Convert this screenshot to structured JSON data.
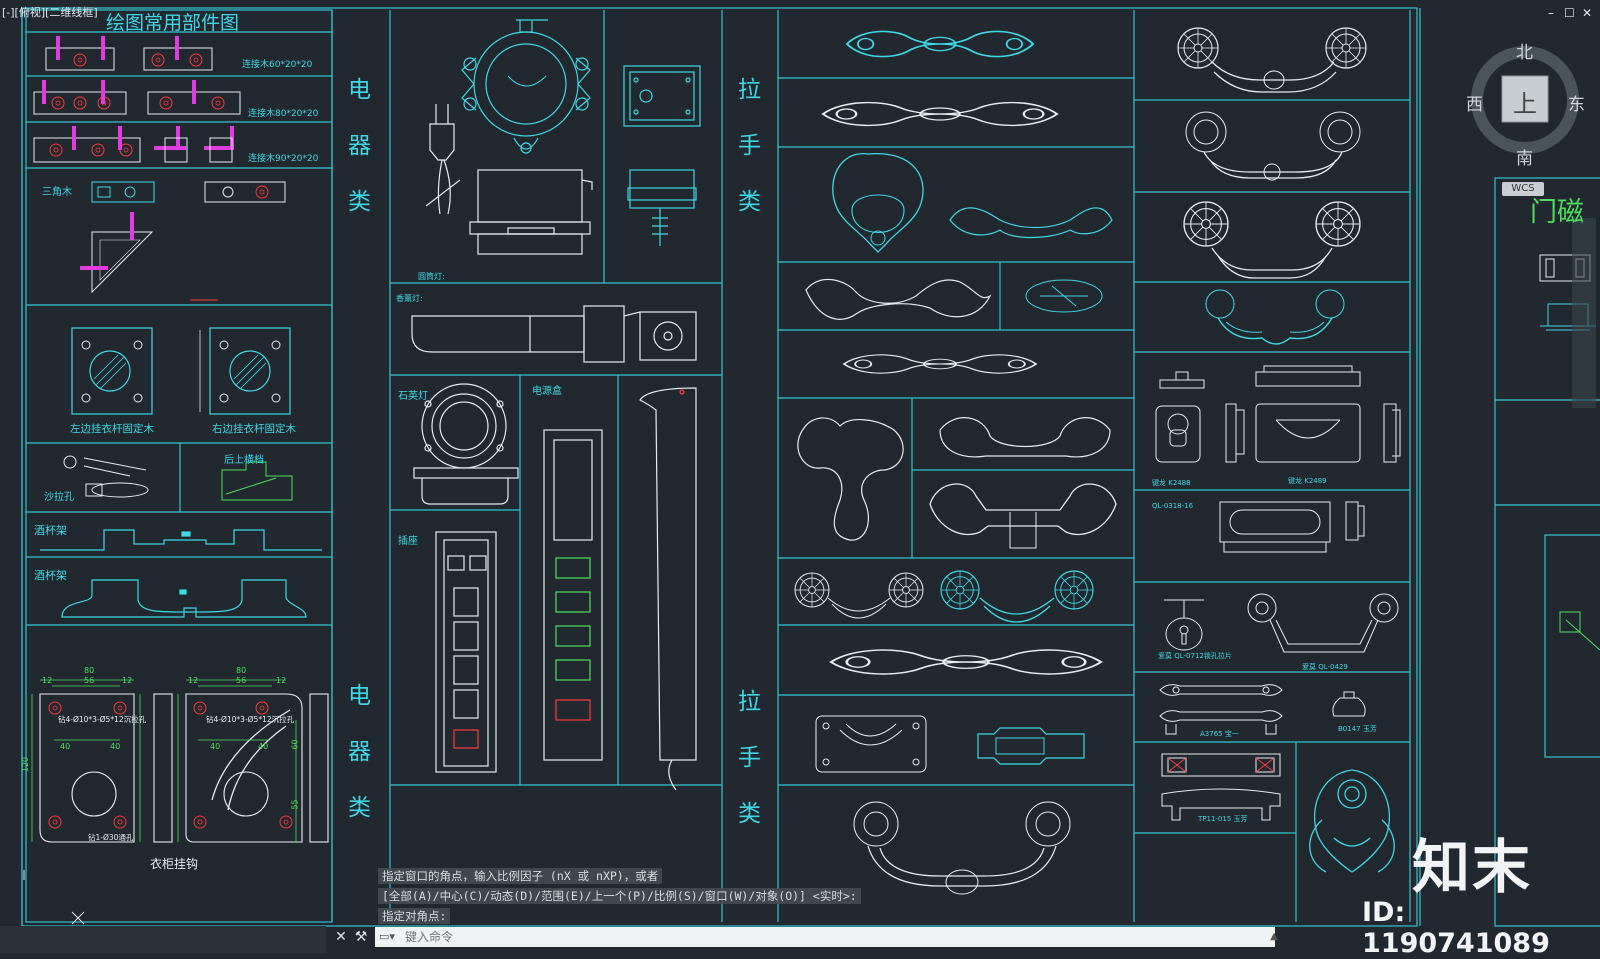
{
  "viewport_label": "[-][俯视][二维线框]",
  "window_controls": [
    "–",
    "☐",
    "✕"
  ],
  "title": "绘图常用部件图",
  "side_labels": {
    "electrical_1": [
      "电",
      "器",
      "类"
    ],
    "electrical_2": [
      "电",
      "器",
      "类"
    ],
    "handle_1": [
      "拉",
      "手",
      "类"
    ],
    "handle_2": [
      "拉",
      "手",
      "类"
    ]
  },
  "part_labels": {
    "connector_60": "连接木60*20*20",
    "connector_80": "连接木80*20*20",
    "connector_90": "连接木90*20*20",
    "triangle_wood": "三角木",
    "left_rod": "左边挂衣杆固定木",
    "right_rod": "右边挂衣杆固定木",
    "sofa_hole": "沙拉孔",
    "rear_rail": "后上横档",
    "wine_rack_1": "酒杯架",
    "wine_rack_2": "酒杯架",
    "wardrobe_hook": "衣柜挂钩",
    "round_lamp": "圆筒灯:",
    "spot_lamp": "香薰灯:",
    "quartz_lamp": "石英灯",
    "power_box": "电源盒",
    "socket": "插座",
    "handle_k2488": "键龙 K2488",
    "handle_k2489": "键龙 K2489",
    "handle_ql0318": "QL-0318-16",
    "handle_ql0712": "爱莫 QL-0712锁孔拉片",
    "handle_ql0429": "爱莫 QL-0429",
    "handle_a3765": "A3765 宝一",
    "handle_b0147": "B0147 玉芳",
    "handle_tp11": "TP11-015 玉芳",
    "door_magnet": "门磁"
  },
  "dimensions": {
    "d80": "80",
    "d56": "56",
    "d12": "12",
    "d40": "40",
    "d60": "60",
    "d120": "120",
    "d55": "55",
    "hole_note": "钻4-Ø10*3-Ø5*12沉拉孔",
    "hole_note2": "钻1-Ø30通孔"
  },
  "command_history": [
    "指定窗口的角点，输入比例因子 (nX 或 nXP)，或者",
    "[全部(A)/中心(C)/动态(D)/范围(E)/上一个(P)/比例(S)/窗口(W)/对象(O)] <实时>:",
    "指定对角点:"
  ],
  "command_input_placeholder": "键入命令",
  "viewcube": {
    "north": "北",
    "south": "南",
    "east": "东",
    "west": "西",
    "top": "上",
    "wcs": "WCS"
  },
  "watermark": {
    "brand": "知末",
    "id": "ID: 1190741089"
  },
  "colors": {
    "background": "#212830",
    "frame": "#36c3d2",
    "drawing_cyan": "#3fd7e6",
    "drawing_white": "#e7ecf1",
    "accent_magenta": "#e23be0",
    "accent_green": "#4be05a",
    "accent_red": "#ff3a3a"
  }
}
